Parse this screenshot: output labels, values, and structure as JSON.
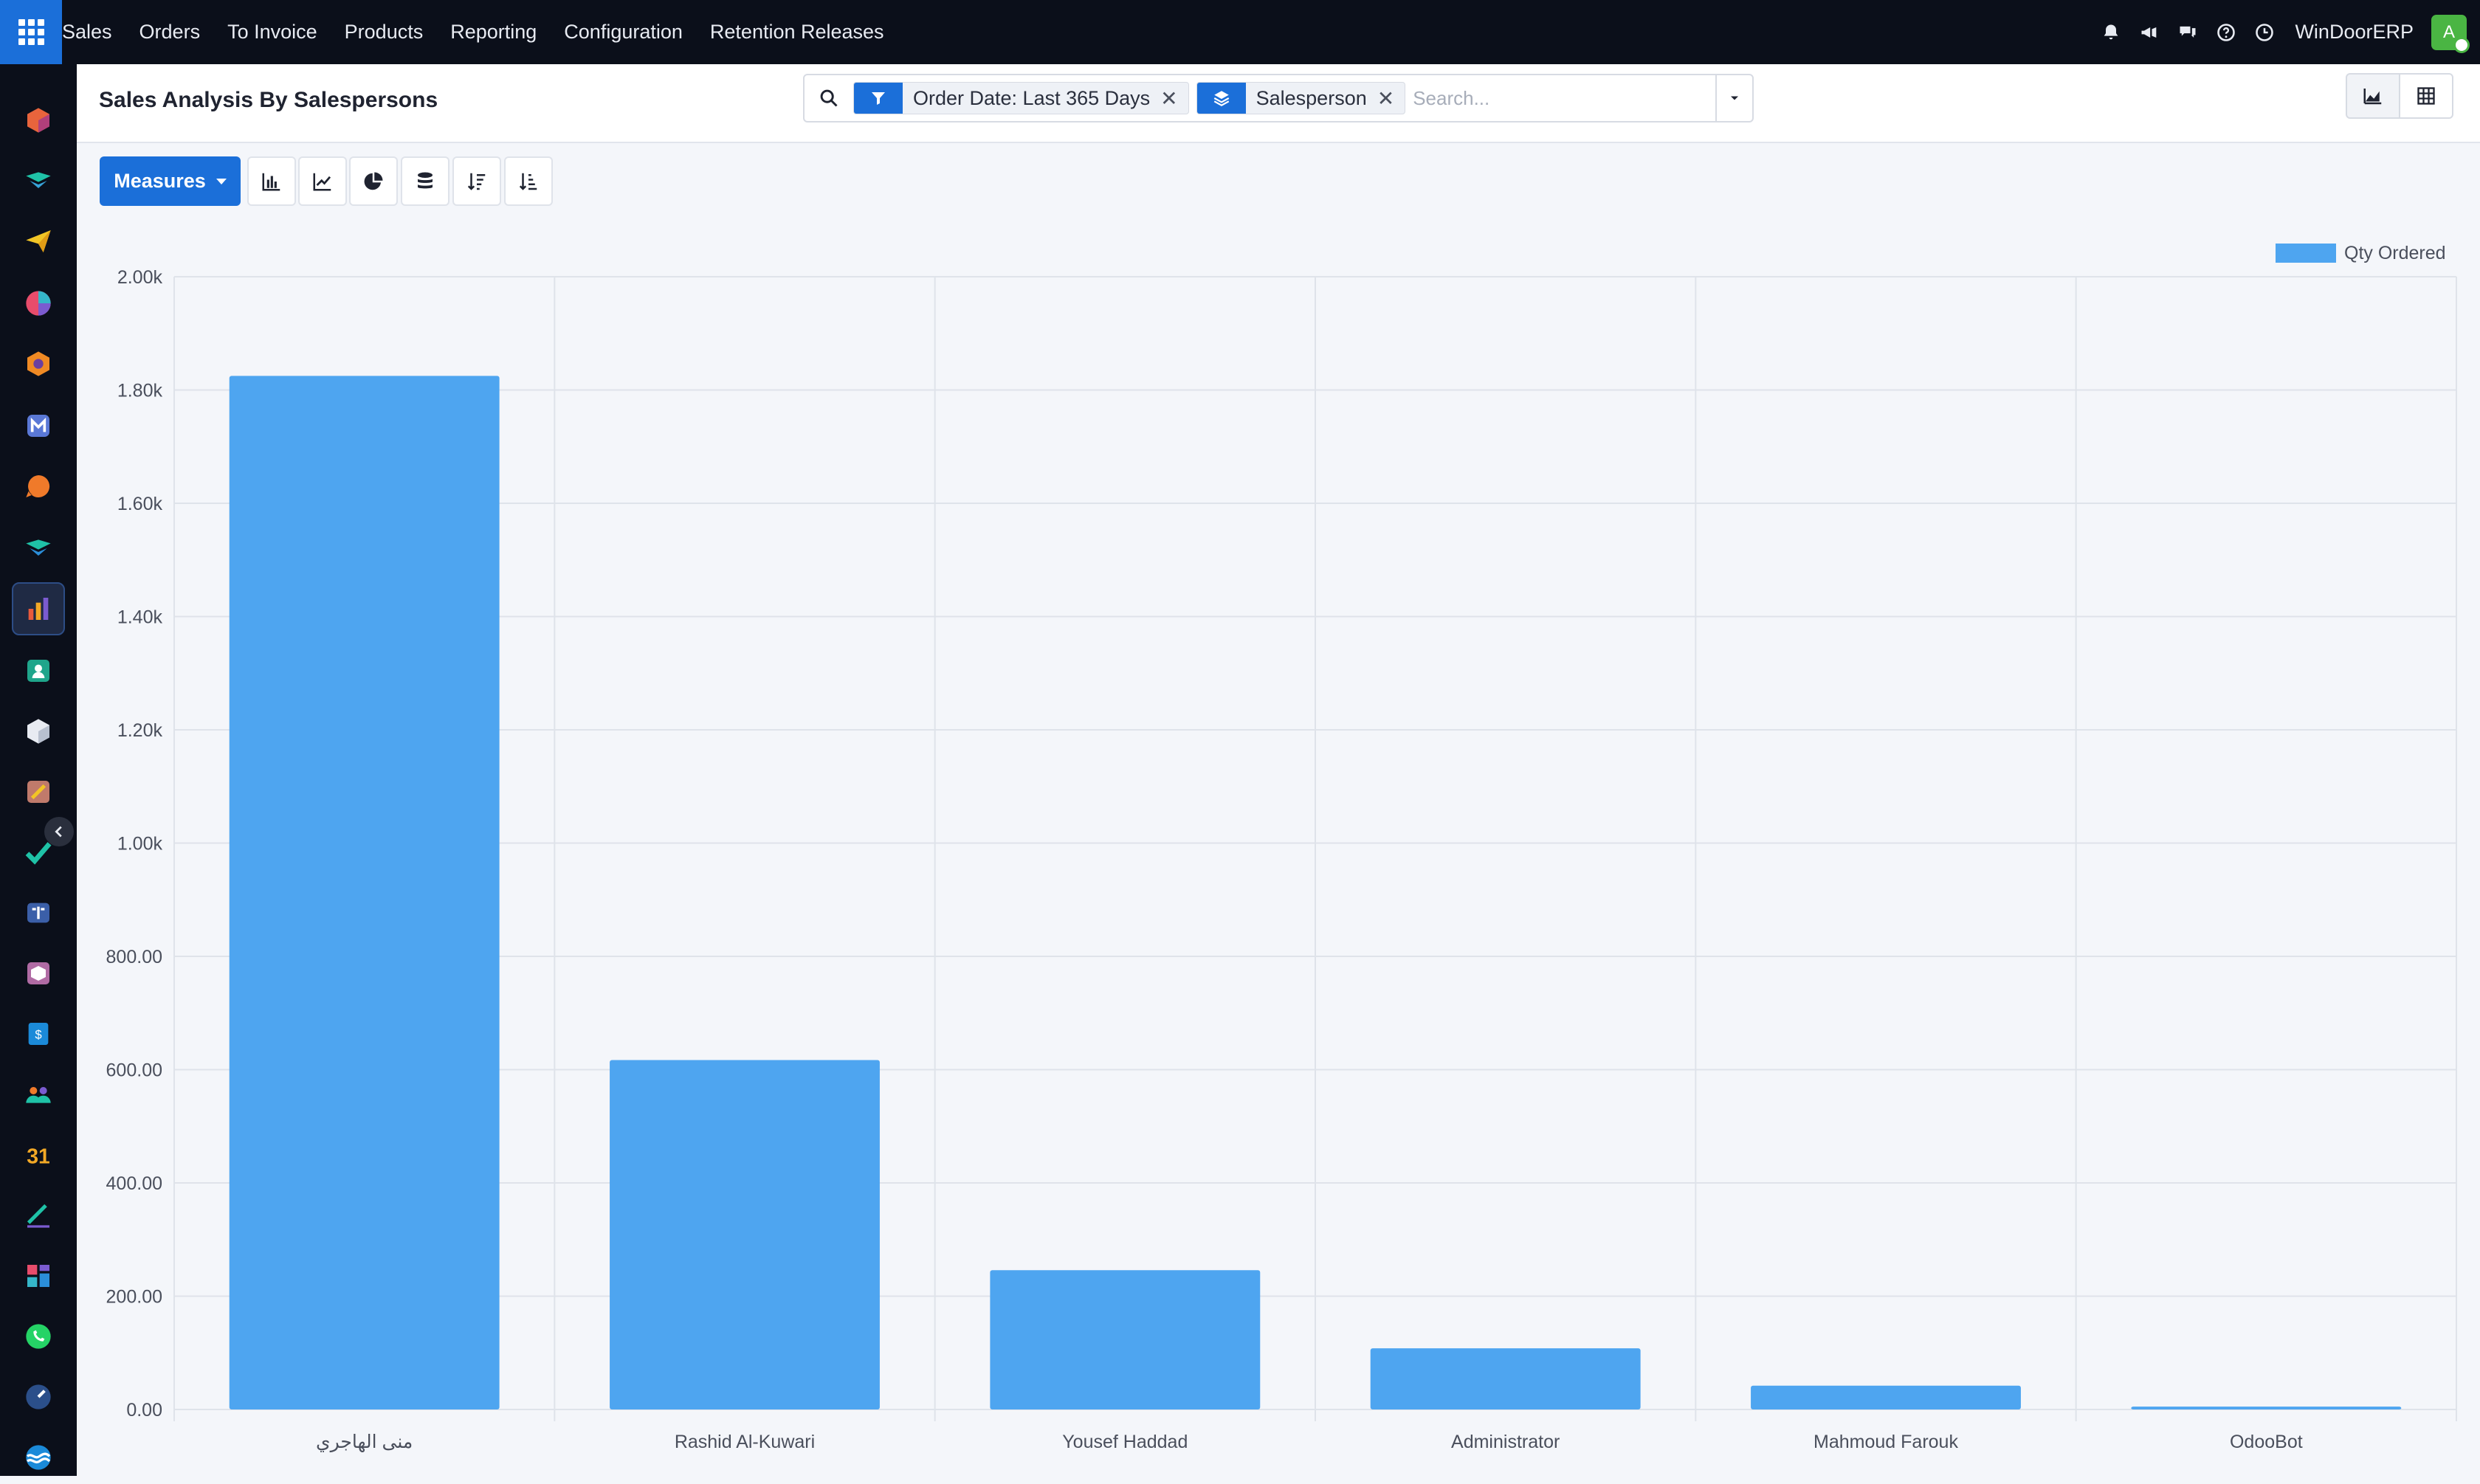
{
  "topbar": {
    "menu": [
      "Sales",
      "Orders",
      "To Invoice",
      "Products",
      "Reporting",
      "Configuration",
      "Retention Releases"
    ],
    "company": "WinDoorERP",
    "avatar_initial": "A",
    "icons": [
      "bell-icon",
      "megaphone-icon",
      "chat-icon",
      "help-icon",
      "clock-icon"
    ]
  },
  "control_panel": {
    "title": "Sales Analysis By Salespersons",
    "facets": [
      {
        "icon": "filter-icon",
        "label": "Order Date: Last 365 Days"
      },
      {
        "icon": "group-by-icon",
        "label": "Salesperson"
      }
    ],
    "search_placeholder": "Search..."
  },
  "toolbar": {
    "measures_label": "Measures",
    "tools": [
      "bar-chart-icon",
      "line-chart-icon",
      "pie-chart-icon",
      "stacked-icon",
      "sort-descending-icon",
      "sort-ascending-icon"
    ]
  },
  "colors": {
    "accent": "#1b6fd9",
    "bar": "#4ea5f0",
    "nav_bg": "#0b0f1a"
  },
  "chart_data": {
    "type": "bar",
    "categories": [
      "منى الهاجري",
      "Rashid Al-Kuwari",
      "Yousef Haddad",
      "Administrator",
      "Mahmoud Farouk",
      "OdooBot"
    ],
    "series": [
      {
        "name": "Qty Ordered",
        "values": [
          1825,
          617,
          246,
          108,
          42,
          5
        ]
      }
    ],
    "y_ticks": [
      "0.00",
      "200.00",
      "400.00",
      "600.00",
      "800.00",
      "1.00k",
      "1.20k",
      "1.40k",
      "1.60k",
      "1.80k",
      "2.00k"
    ],
    "ylim": [
      0,
      2000
    ],
    "legend": "top-right",
    "grid": true
  }
}
